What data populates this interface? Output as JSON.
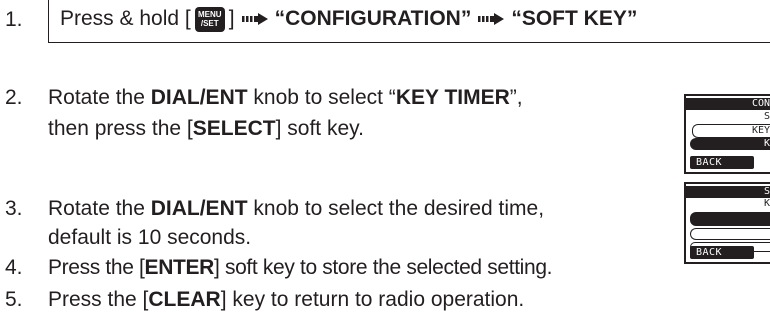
{
  "step1": {
    "number": "1.",
    "prefix": "Press & hold [",
    "key_line1": "MENU",
    "key_line2": "/SET",
    "mid": "]",
    "item1": "“CONFIGURATION”",
    "item2": "“SOFT KEY”"
  },
  "step2": {
    "number": "2.",
    "line1_a": "Rotate the ",
    "line1_b": "DIAL/ENT",
    "line1_c": " knob to select “",
    "line1_d": "KEY TIMER",
    "line1_e": "”,",
    "line2_a": "then press the [",
    "line2_b": "SELECT",
    "line2_c": "] soft key."
  },
  "step3": {
    "number": "3.",
    "line1_a": "Rotate the ",
    "line1_b": "DIAL/ENT",
    "line1_c": " knob to select the desired time,",
    "line2": "default is 10 seconds."
  },
  "step4": {
    "number": "4.",
    "a": "Press the [",
    "b": "ENTER",
    "c": "] soft key to store the selected setting."
  },
  "step5": {
    "number": "5.",
    "a": "Press the [",
    "b": "CLEAR",
    "c": "] key to return to radio operation."
  },
  "screen1": {
    "header": "CON",
    "row1": "S",
    "row2": "KEY",
    "row3": "K",
    "back": "BACK"
  },
  "screen2": {
    "header": "S",
    "row1": "K",
    "back": "BACK"
  }
}
